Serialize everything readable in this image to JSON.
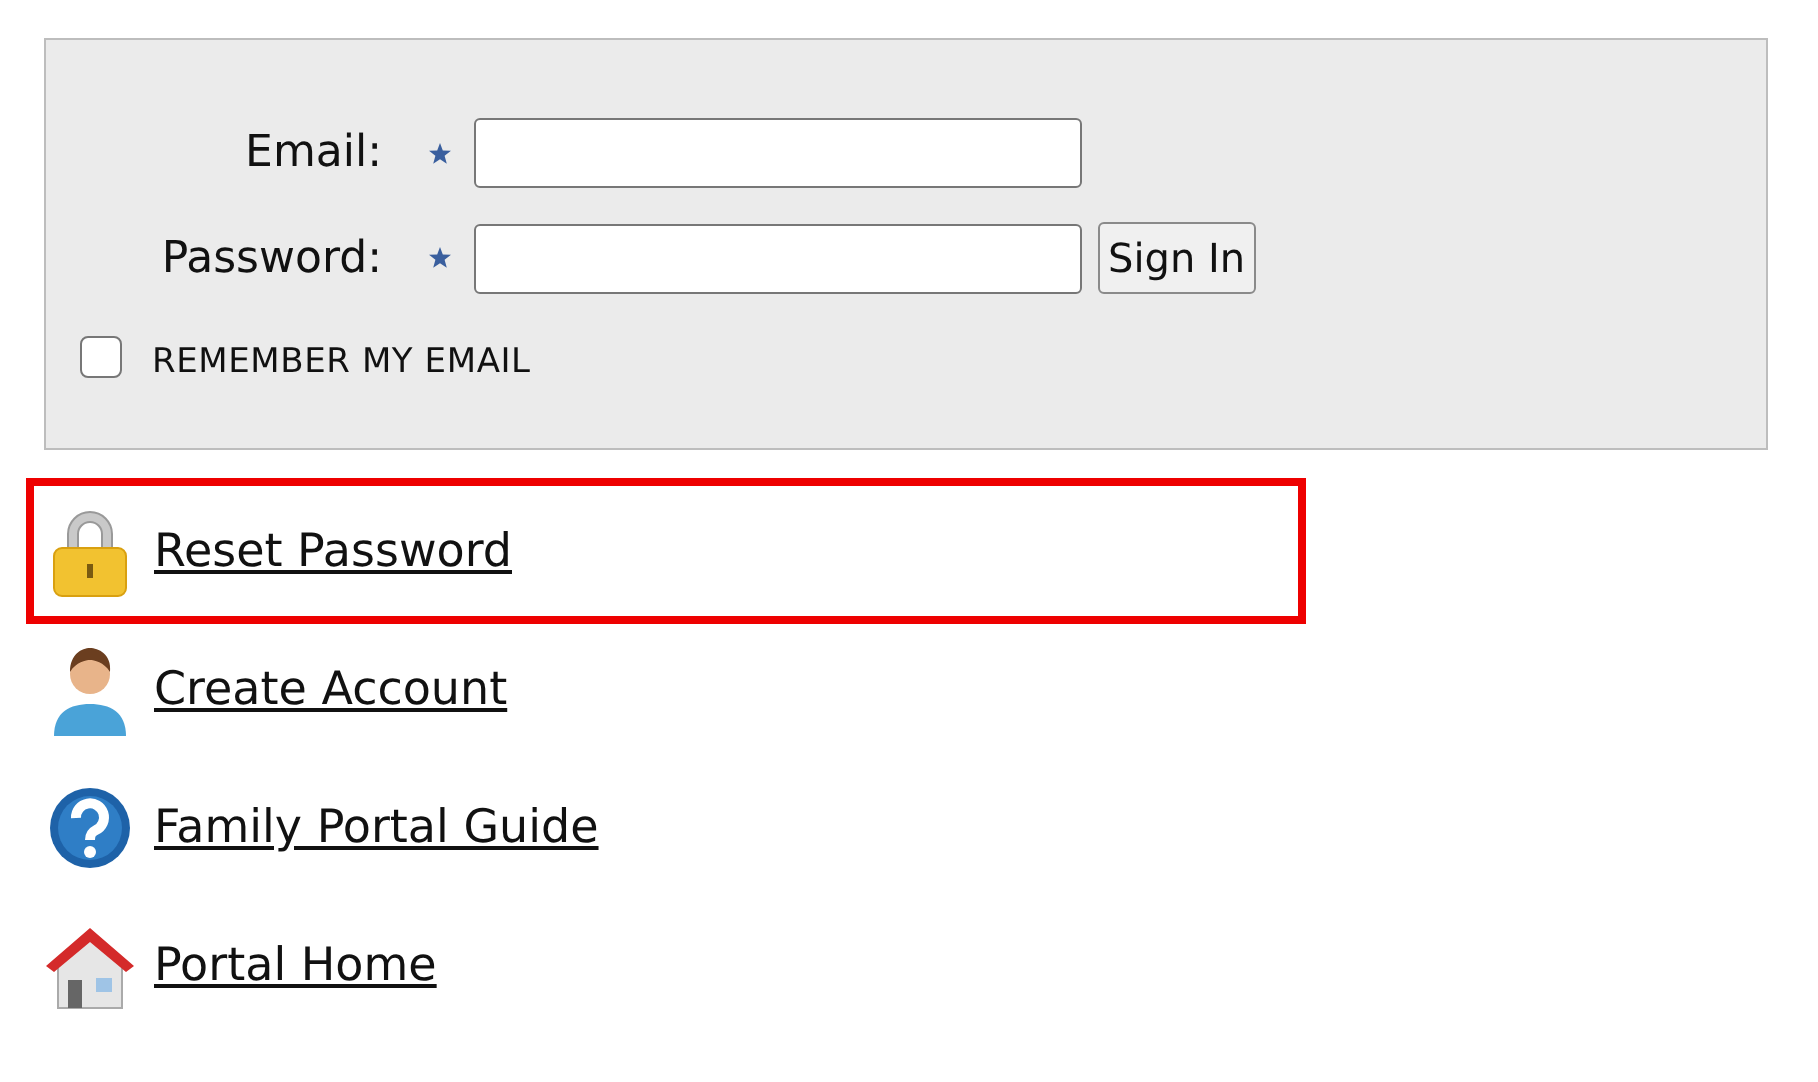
{
  "login": {
    "fields": [
      {
        "label": "Email:",
        "required": true
      },
      {
        "label": "Password:",
        "required": true
      }
    ],
    "button": "Sign In",
    "remember": {
      "label": "REMEMBER MY EMAIL",
      "checked": false
    }
  },
  "links": [
    {
      "label": "Reset Password",
      "kind": "lock",
      "highlighted": true
    },
    {
      "label": "Create Account",
      "kind": "person",
      "highlighted": false
    },
    {
      "label": "Family Portal Guide",
      "kind": "help",
      "highlighted": false
    },
    {
      "label": "Portal Home",
      "kind": "home",
      "highlighted": false
    }
  ]
}
